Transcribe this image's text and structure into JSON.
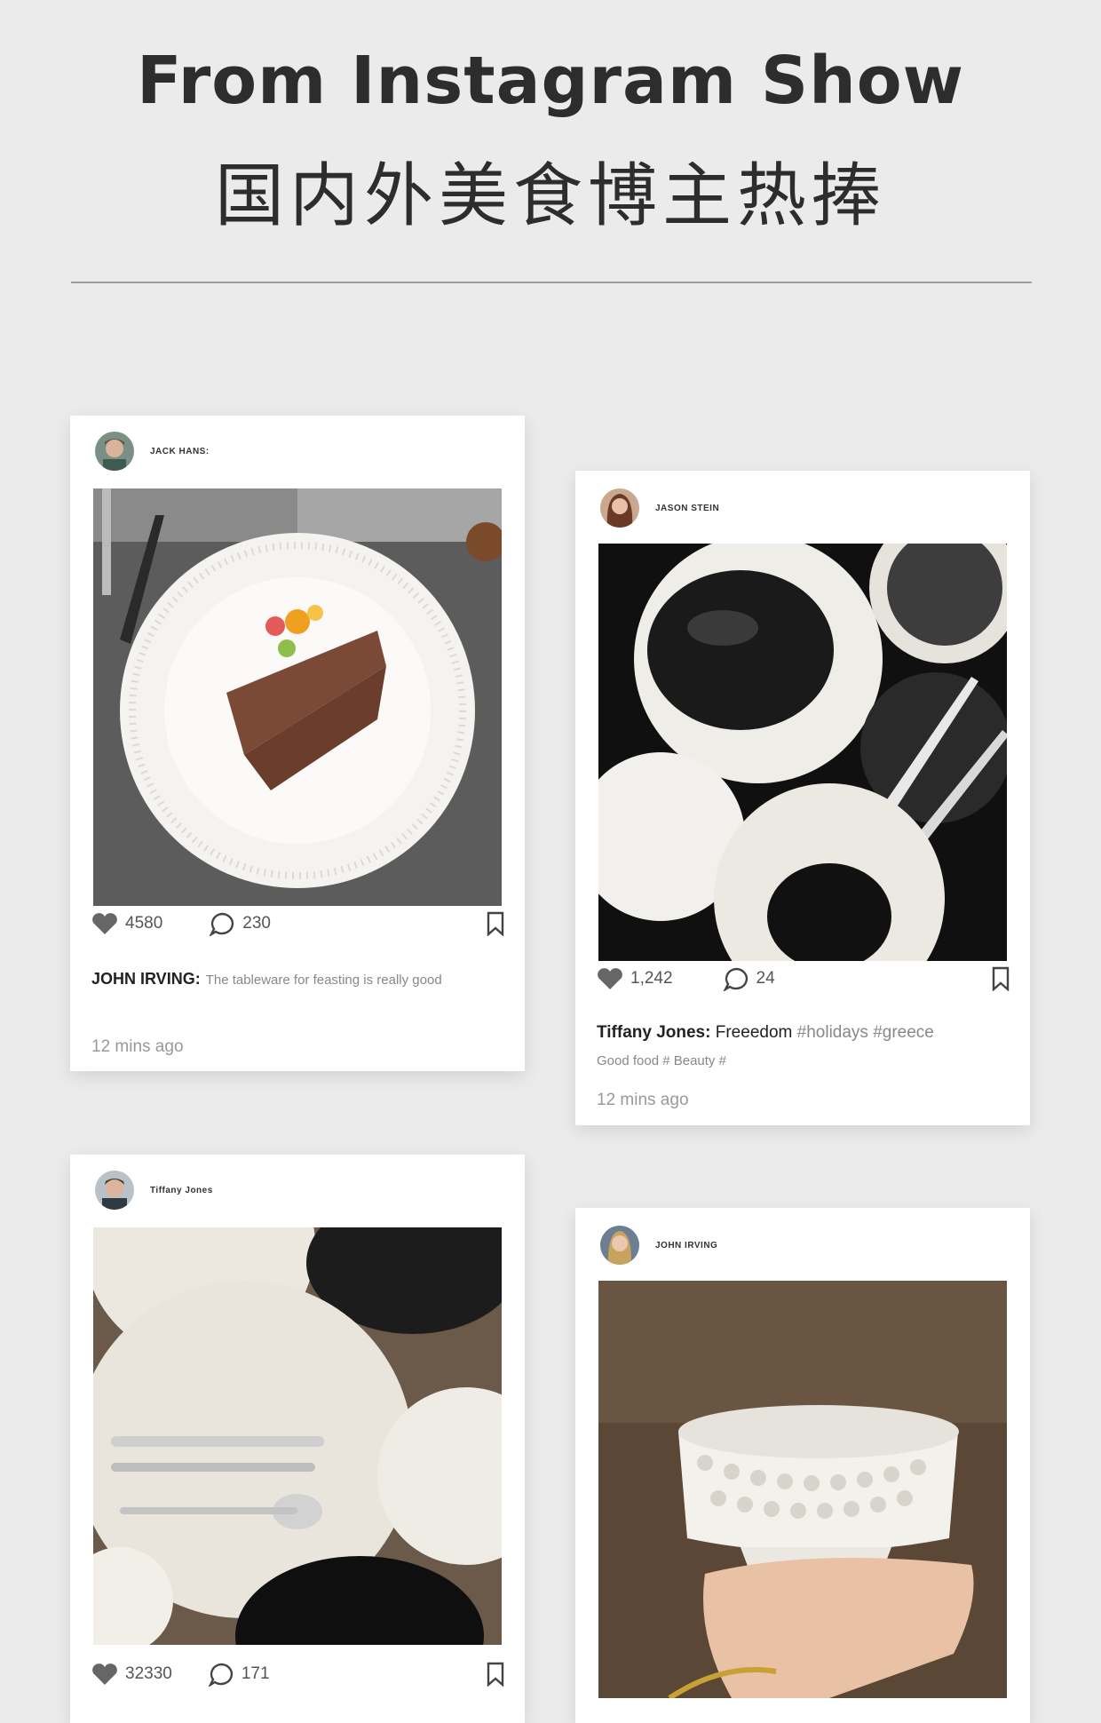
{
  "header": {
    "title_en": "From Instagram Show",
    "title_cn": "国内外美食博主热捧"
  },
  "posts": [
    {
      "username": "JACK HANS:",
      "likes": "4580",
      "comments": "230",
      "author": "JOHN IRVING:",
      "caption": "The tableware for feasting is really good",
      "time": "12 mins ago"
    },
    {
      "username": "JASON STEIN",
      "likes": "1,242",
      "comments": "24",
      "author": "Tiffany Jones:",
      "caption": "Freeedom",
      "hashtags": "#holidays #greece",
      "subcaption": "Good food # Beauty #",
      "time": "12 mins ago"
    },
    {
      "username": "Tiffany Jones",
      "likes": "32330",
      "comments": "171"
    },
    {
      "username": "JOHN IRVING"
    }
  ],
  "icons": {
    "like": "heart-icon",
    "comment": "comment-bubble-icon",
    "save": "bookmark-icon"
  },
  "colors": {
    "background": "#ebebeb",
    "card": "#ffffff",
    "title": "#2d2d2d"
  }
}
